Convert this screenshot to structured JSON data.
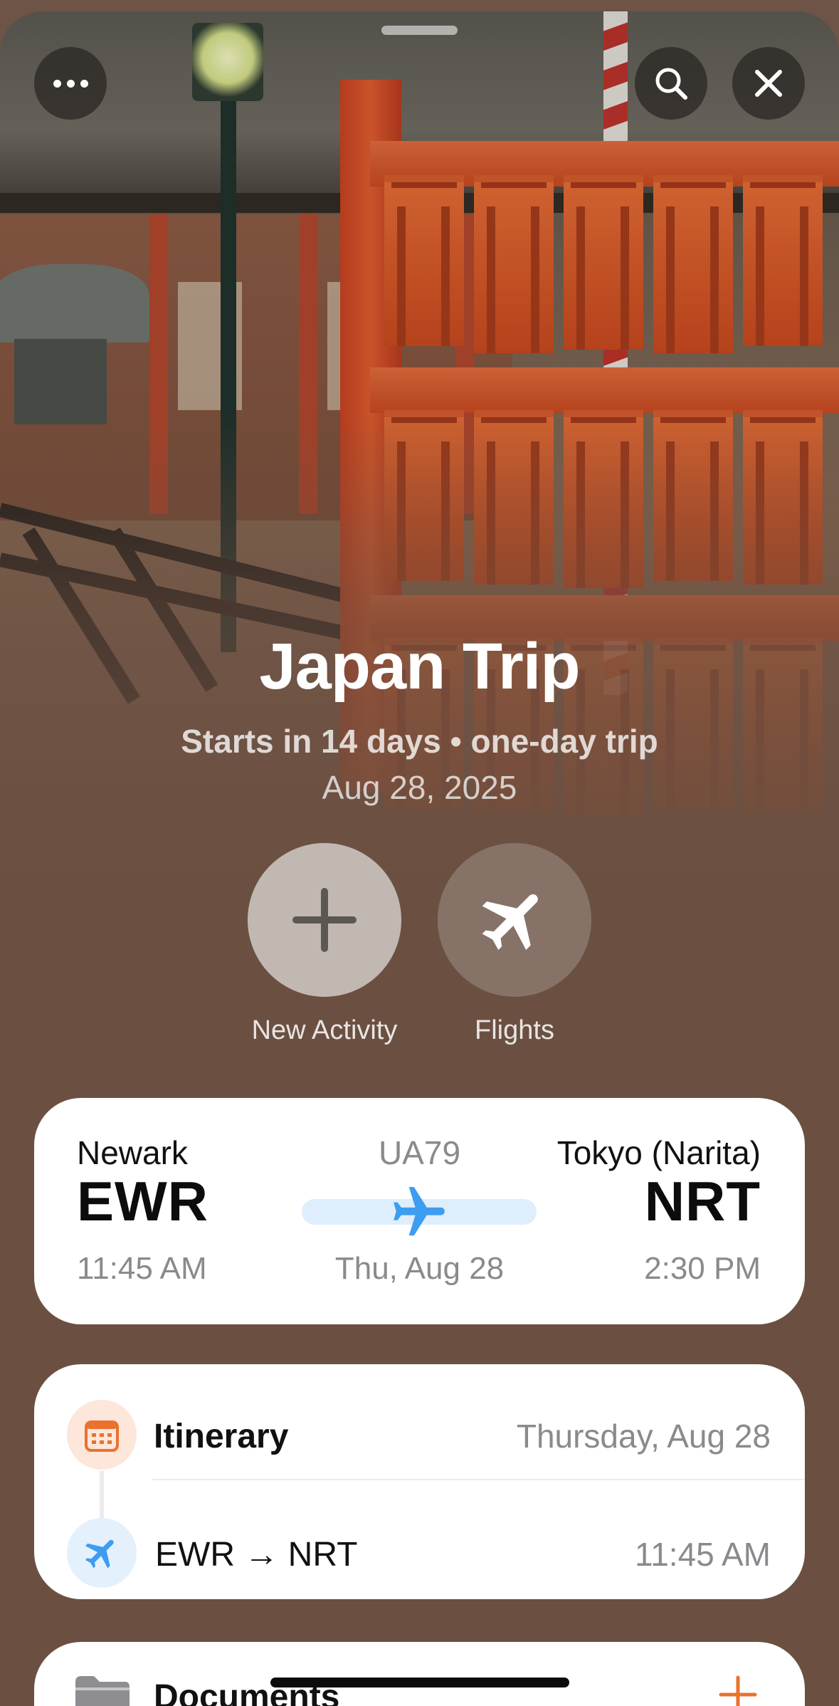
{
  "header": {
    "more_icon": "ellipsis-icon",
    "search_icon": "magnifier-icon",
    "close_icon": "xmark-icon"
  },
  "trip": {
    "title": "Japan Trip",
    "subtitle": "Starts in 14 days • one-day trip",
    "date": "Aug 28, 2025"
  },
  "actions": [
    {
      "label": "New Activity",
      "icon": "plus-icon"
    },
    {
      "label": "Flights",
      "icon": "airplane-icon"
    }
  ],
  "flight": {
    "origin_city": "Newark",
    "origin_code": "EWR",
    "depart_time": "11:45 AM",
    "flight_number": "UA79",
    "date": "Thu, Aug 28",
    "dest_city": "Tokyo (Narita)",
    "dest_code": "NRT",
    "arrive_time": "2:30 PM"
  },
  "itinerary": {
    "title": "Itinerary",
    "day": "Thursday, Aug 28",
    "items": [
      {
        "label": "EWR → NRT",
        "time": "11:45 AM",
        "icon": "airplane-icon"
      }
    ]
  },
  "documents": {
    "title": "Documents",
    "add_icon": "plus-icon"
  },
  "colors": {
    "accent_orange": "#e9722e",
    "accent_blue": "#3d9df0"
  }
}
